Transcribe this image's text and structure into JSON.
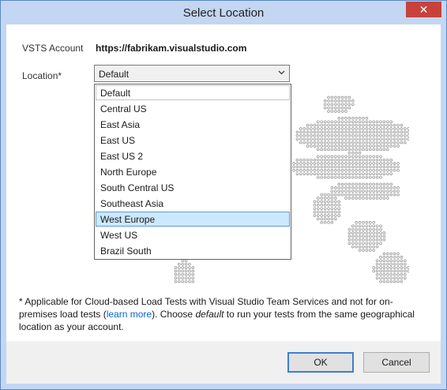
{
  "window": {
    "title": "Select Location",
    "close_glyph": "✕"
  },
  "account": {
    "label": "VSTS Account",
    "value": "https://fabrikam.visualstudio.com"
  },
  "location": {
    "label": "Location*",
    "selected": "Default",
    "options": [
      "Default",
      "Central US",
      "East Asia",
      "East US",
      "East US 2",
      "North Europe",
      "South Central US",
      "Southeast Asia",
      "West Europe",
      "West US",
      "Brazil South"
    ],
    "highlighted_option": "West Europe",
    "hovered_option": "Default"
  },
  "note": {
    "part1": "* Applicable for Cloud-based Load Tests with Visual Studio ",
    "team_services": "Team Services",
    "part2": " and not for on-premises load  tests (",
    "link": "learn more",
    "part3": "). Choose ",
    "default_word": "default",
    "part4": " to run your tests from the same geographical location as your account."
  },
  "buttons": {
    "ok": "OK",
    "cancel": "Cancel"
  },
  "colors": {
    "title_bar": "#c3d6f2",
    "close_button": "#c7423b",
    "selection": "#cce8ff",
    "link": "#0066cc",
    "map_dots": "#8a8a8a"
  },
  "icons": {
    "dropdown": "chevron-down-icon",
    "close": "close-icon",
    "background": "world-map-dots"
  }
}
